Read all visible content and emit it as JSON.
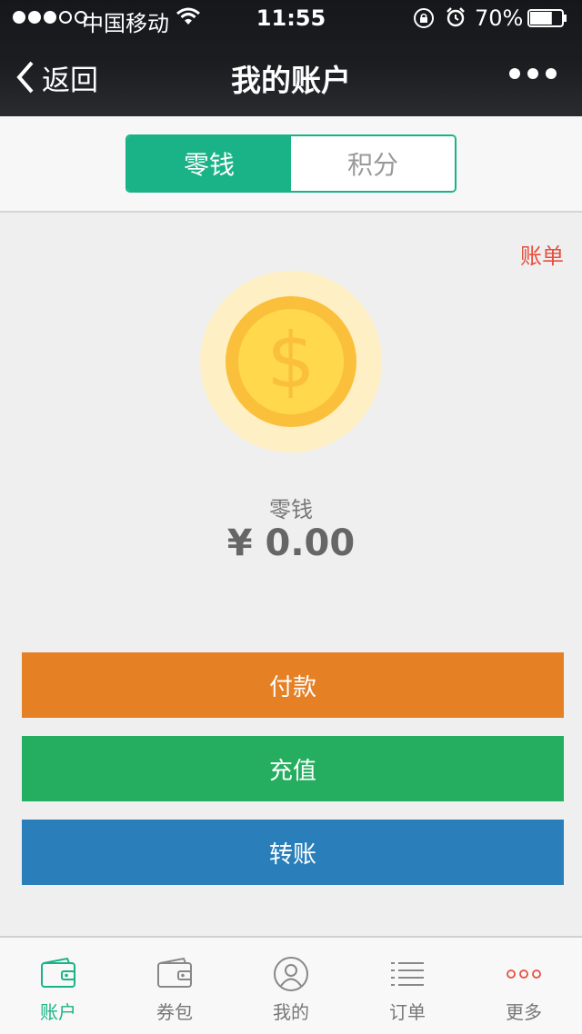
{
  "status_bar": {
    "carrier": "中国移动",
    "time": "11:55",
    "battery_percent": "70%",
    "battery_level": 0.7,
    "signal_bars_filled": 3,
    "signal_bars_total": 5
  },
  "nav": {
    "back_label": "返回",
    "title": "我的账户"
  },
  "segments": [
    {
      "label": "零钱",
      "active": true
    },
    {
      "label": "积分",
      "active": false
    }
  ],
  "bill_link": "账单",
  "balance": {
    "label": "零钱",
    "amount": "¥ 0.00"
  },
  "actions": {
    "pay": "付款",
    "recharge": "充值",
    "transfer": "转账"
  },
  "tabbar": [
    {
      "label": "账户",
      "icon": "wallet-icon",
      "active": true
    },
    {
      "label": "券包",
      "icon": "coupon-wallet-icon",
      "active": false
    },
    {
      "label": "我的",
      "icon": "user-icon",
      "active": false
    },
    {
      "label": "订单",
      "icon": "list-icon",
      "active": false
    },
    {
      "label": "更多",
      "icon": "more-dots-icon",
      "active": false
    }
  ],
  "colors": {
    "accent": "#1ab387",
    "pay": "#e58024",
    "recharge": "#25ae5f",
    "transfer": "#2a7fbb",
    "bill_link": "#e64e3e"
  }
}
